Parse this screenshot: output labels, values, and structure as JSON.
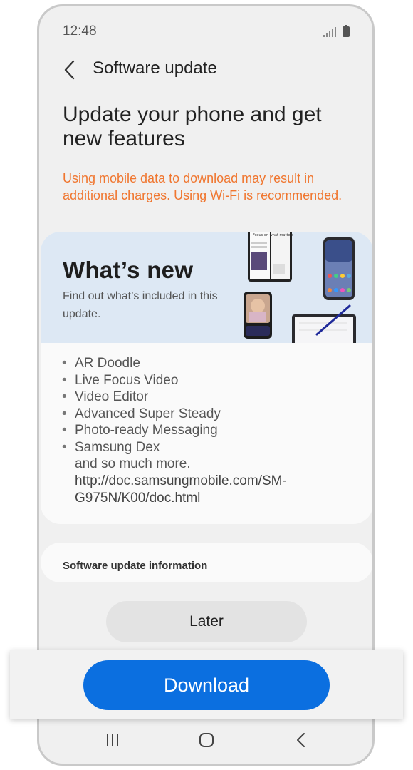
{
  "status_bar": {
    "time": "12:48"
  },
  "header": {
    "title": "Software update"
  },
  "headline": "Update your phone and get new features",
  "warning": "Using mobile data to download may result in additional charges. Using Wi-Fi is recommended.",
  "whats_new": {
    "title": "What’s new",
    "subtitle": "Find out what’s included in this update.",
    "promo_text": "Focus on what matters",
    "features": [
      "AR Doodle",
      "Live Focus Video",
      "Video Editor",
      "Advanced Super Steady",
      "Photo-ready Messaging",
      "Samsung Dex"
    ],
    "more_text": "and so much more.",
    "link": "http://doc.samsungmobile.com/SM-G975N/K00/doc.html"
  },
  "info": {
    "label": "Software update information"
  },
  "actions": {
    "later": "Later",
    "download": "Download"
  },
  "colors": {
    "accent": "#0b6fe0",
    "warning": "#f0762f",
    "banner": "#dde8f4"
  },
  "icons": {
    "back": "chevron-left-icon",
    "signal": "signal-icon",
    "battery": "battery-icon",
    "nav_recents": "recents-icon",
    "nav_home": "home-icon",
    "nav_back": "back-icon"
  }
}
